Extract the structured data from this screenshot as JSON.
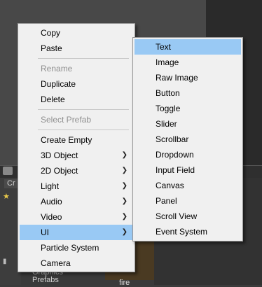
{
  "background": {
    "scene_tab_label": "Cr",
    "tree_items": [
      "Graphics",
      "Prefabs"
    ],
    "asset_caption": "fire"
  },
  "context_menu": {
    "items": [
      {
        "label": "Copy"
      },
      {
        "label": "Paste"
      },
      {
        "label": "Rename"
      },
      {
        "label": "Duplicate"
      },
      {
        "label": "Delete"
      },
      {
        "label": "Select Prefab"
      },
      {
        "label": "Create Empty"
      },
      {
        "label": "3D Object"
      },
      {
        "label": "2D Object"
      },
      {
        "label": "Light"
      },
      {
        "label": "Audio"
      },
      {
        "label": "Video"
      },
      {
        "label": "UI"
      },
      {
        "label": "Particle System"
      },
      {
        "label": "Camera"
      }
    ]
  },
  "submenu_ui": {
    "items": [
      {
        "label": "Text"
      },
      {
        "label": "Image"
      },
      {
        "label": "Raw Image"
      },
      {
        "label": "Button"
      },
      {
        "label": "Toggle"
      },
      {
        "label": "Slider"
      },
      {
        "label": "Scrollbar"
      },
      {
        "label": "Dropdown"
      },
      {
        "label": "Input Field"
      },
      {
        "label": "Canvas"
      },
      {
        "label": "Panel"
      },
      {
        "label": "Scroll View"
      },
      {
        "label": "Event System"
      }
    ]
  },
  "colors": {
    "menu_bg": "#f0f0f0",
    "highlight": "#99c9f4",
    "disabled_text": "#8f8f8f"
  }
}
